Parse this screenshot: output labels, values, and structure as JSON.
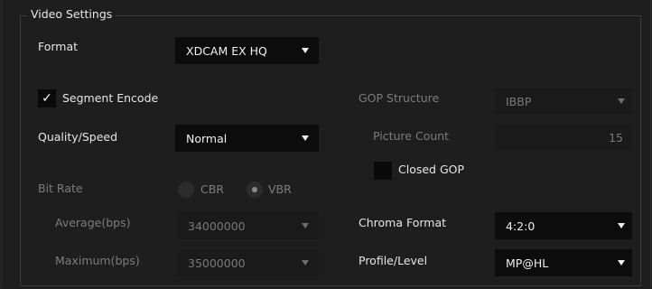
{
  "group": {
    "title": "Video Settings"
  },
  "format": {
    "label": "Format",
    "value": "XDCAM EX HQ"
  },
  "segment_encode": {
    "label": "Segment Encode",
    "checked": true,
    "check_glyph": "✓"
  },
  "quality_speed": {
    "label": "Quality/Speed",
    "value": "Normal"
  },
  "bit_rate": {
    "label": "Bit Rate",
    "cbr_label": "CBR",
    "vbr_label": "VBR",
    "selected": "VBR",
    "average_label": "Average(bps)",
    "average_value": "34000000",
    "maximum_label": "Maximum(bps)",
    "maximum_value": "35000000"
  },
  "gop_structure": {
    "label": "GOP Structure",
    "value": "IBBP"
  },
  "picture_count": {
    "label": "Picture Count",
    "value": "15"
  },
  "closed_gop": {
    "label": "Closed GOP",
    "checked": false
  },
  "chroma_format": {
    "label": "Chroma Format",
    "value": "4:2:0"
  },
  "profile_level": {
    "label": "Profile/Level",
    "value": "MP@HL"
  }
}
